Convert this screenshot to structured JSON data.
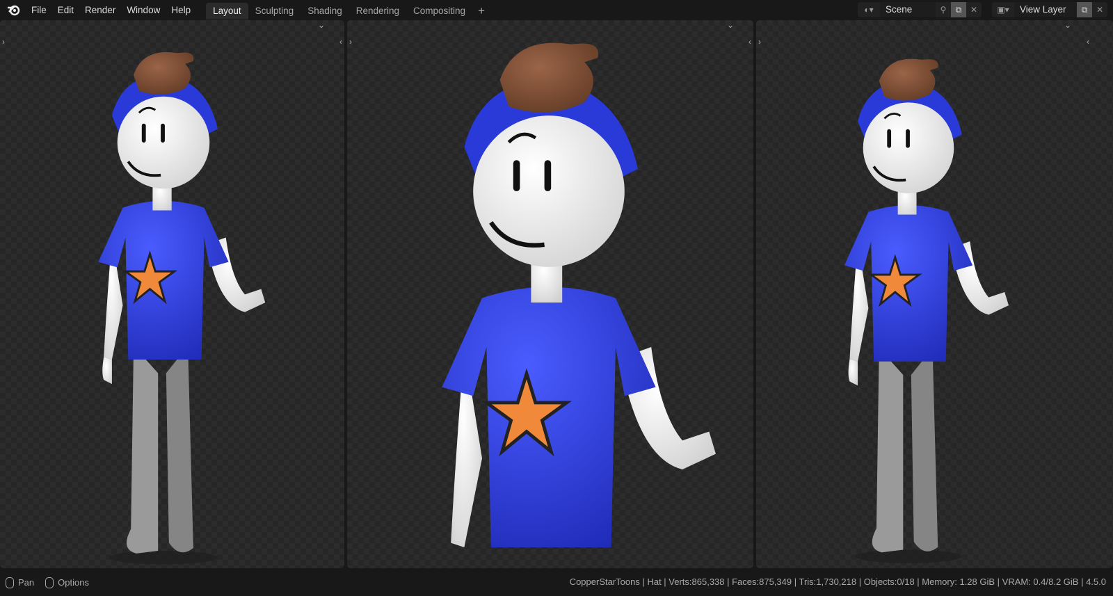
{
  "menu": [
    "File",
    "Edit",
    "Render",
    "Window",
    "Help"
  ],
  "workspaces": [
    {
      "label": "Layout",
      "active": true
    },
    {
      "label": "Sculpting"
    },
    {
      "label": "Shading"
    },
    {
      "label": "Rendering"
    },
    {
      "label": "Compositing"
    }
  ],
  "add_workspace": "+",
  "scene": {
    "name": "Scene"
  },
  "view_layer": {
    "name": "View Layer"
  },
  "status": {
    "pan": "Pan",
    "options": "Options",
    "stats": "CopperStarToons | Hat | Verts:865,338 | Faces:875,349 | Tris:1,730,218 | Objects:0/18 | Memory: 1.28 GiB | VRAM: 0.4/8.2 GiB | 4.5.0"
  },
  "colors": {
    "shirt": "#2f3fe0",
    "star": "#f08a3a",
    "hair": "#7a4a30",
    "pants": "#8e8e8e",
    "accent": "#2b2b2b"
  }
}
